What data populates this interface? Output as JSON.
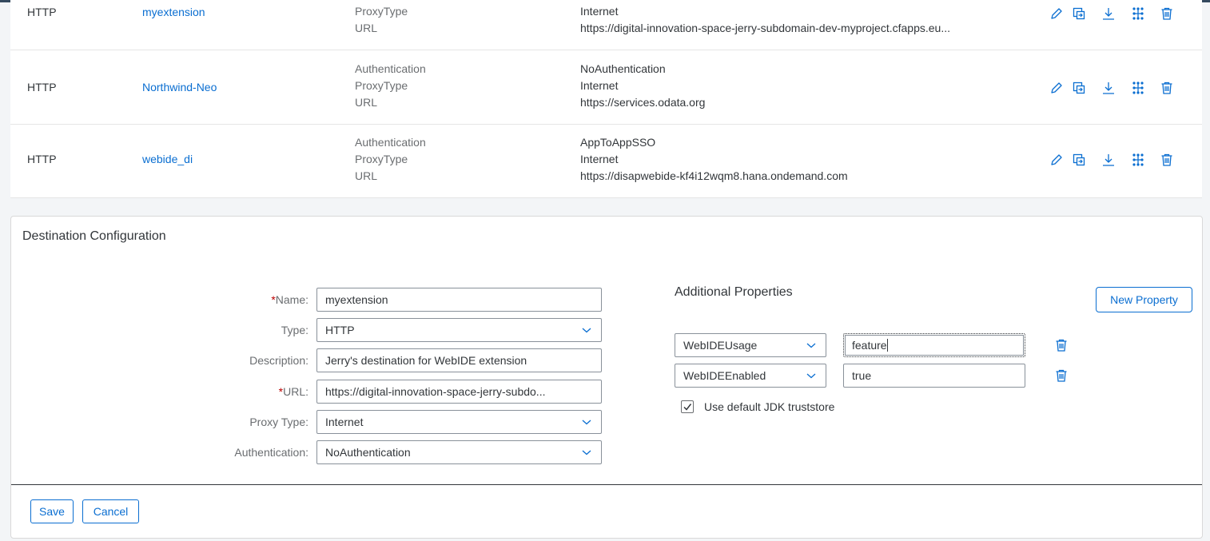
{
  "destinations": [
    {
      "type": "HTTP",
      "name": "myextension",
      "properties": [
        "ProxyType",
        "URL"
      ],
      "values": [
        "Internet",
        "https://digital-innovation-space-jerry-subdomain-dev-myproject.cfapps.eu..."
      ]
    },
    {
      "type": "HTTP",
      "name": "Northwind-Neo",
      "properties": [
        "Authentication",
        "ProxyType",
        "URL"
      ],
      "values": [
        "NoAuthentication",
        "Internet",
        "https://services.odata.org"
      ]
    },
    {
      "type": "HTTP",
      "name": "webide_di",
      "properties": [
        "Authentication",
        "ProxyType",
        "URL"
      ],
      "values": [
        "AppToAppSSO",
        "Internet",
        "https://disapwebide-kf4i12wqm8.hana.ondemand.com"
      ]
    }
  ],
  "row_actions": [
    "edit-icon",
    "clone-icon",
    "download-icon",
    "check-connection-icon",
    "delete-icon"
  ],
  "config": {
    "title": "Destination Configuration",
    "name_label": "Name:",
    "name_value": "myextension",
    "type_label": "Type:",
    "type_value": "HTTP",
    "description_label": "Description:",
    "description_value": "Jerry's destination for WebIDE extension",
    "url_label": "URL:",
    "url_value": "https://digital-innovation-space-jerry-subdo...",
    "proxy_label": "Proxy Type:",
    "proxy_value": "Internet",
    "auth_label": "Authentication:",
    "auth_value": "NoAuthentication",
    "required_mark": "*"
  },
  "additional": {
    "title": "Additional Properties",
    "new_property_label": "New Property",
    "properties": [
      {
        "key": "WebIDEUsage",
        "value": "feature"
      },
      {
        "key": "WebIDEEnabled",
        "value": "true"
      }
    ],
    "truststore_label": "Use default JDK truststore",
    "truststore_checked": true
  },
  "footer": {
    "save_label": "Save",
    "cancel_label": "Cancel"
  },
  "colors": {
    "accent": "#0a6ed1",
    "header_bar": "#354a5f",
    "required": "#bb0000"
  }
}
